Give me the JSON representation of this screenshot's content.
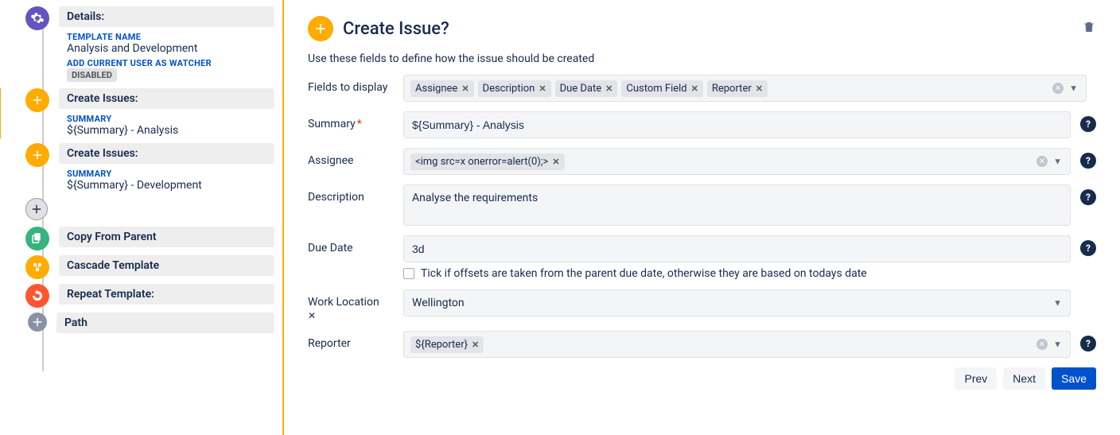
{
  "sidebar": {
    "details": {
      "header": "Details:",
      "tmpl_label": "TEMPLATE NAME",
      "tmpl_value": "Analysis and Development",
      "watcher_label": "ADD CURRENT USER AS WATCHER",
      "watcher_value": "DISABLED"
    },
    "create1": {
      "header": "Create Issues:",
      "summary_label": "SUMMARY",
      "summary_value": "${Summary} - Analysis"
    },
    "create2": {
      "header": "Create Issues:",
      "summary_label": "SUMMARY",
      "summary_value": "${Summary} - Development"
    },
    "copy": {
      "header": "Copy From Parent"
    },
    "cascade": {
      "header": "Cascade Template"
    },
    "repeat": {
      "header": "Repeat Template:"
    },
    "path": {
      "header": "Path"
    }
  },
  "main": {
    "title": "Create Issue?",
    "subtitle": "Use these fields to define how the issue should be created",
    "fields_label": "Fields to display",
    "chips": [
      "Assignee",
      "Description",
      "Due Date",
      "Custom Field",
      "Reporter"
    ],
    "summary_label": "Summary",
    "summary_value": "${Summary} - Analysis",
    "assignee_label": "Assignee",
    "assignee_chip": "<img src=x onerror=alert(0);>",
    "description_label": "Description",
    "description_value": "Analyse the requirements",
    "duedate_label": "Due Date",
    "duedate_value": "3d",
    "duedate_check": "Tick if offsets are taken from the parent due date, otherwise they are based on todays date",
    "worklocation_label": "Work Location",
    "worklocation_value": "Wellington",
    "reporter_label": "Reporter",
    "reporter_chip": "${Reporter}",
    "buttons": {
      "prev": "Prev",
      "next": "Next",
      "save": "Save"
    }
  }
}
